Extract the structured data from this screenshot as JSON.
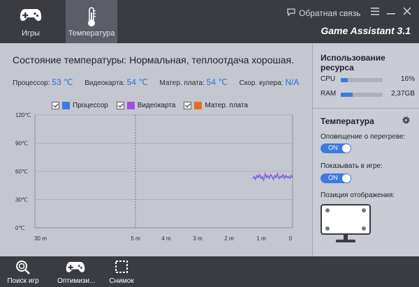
{
  "header": {
    "tabs": [
      {
        "label": "Игры",
        "icon": "gamepad-icon"
      },
      {
        "label": "Температура",
        "icon": "thermometer-icon"
      }
    ],
    "feedback_label": "Обратная связь",
    "brand": "Game Assistant 3.1"
  },
  "status": {
    "text": "Состояние температуры: Нормальная, теплоотдача хорошая."
  },
  "readings": {
    "cpu_label": "Процессор:",
    "cpu_value": "53 ℃",
    "gpu_label": "Видеокарта:",
    "gpu_value": "54 ℃",
    "mb_label": "Матер. плата:",
    "mb_value": "54 ℃",
    "fan_label": "Скор. кулера:",
    "fan_value": "N/A"
  },
  "chart_data": {
    "type": "line",
    "legend": [
      "Процессор",
      "Видеокарта",
      "Матер. плата"
    ],
    "colors": {
      "cpu": "#3b7be0",
      "gpu": "#a24fe0",
      "mb": "#ee6a2a"
    },
    "y_ticks": [
      "120℃",
      "90℃",
      "60℃",
      "30℃",
      "0℃"
    ],
    "ylim": [
      0,
      120
    ],
    "x_ticks": [
      "30 m",
      "5 m",
      "4 m",
      "3 m",
      "2 m",
      "1 m",
      "0"
    ],
    "grid": true,
    "series": [
      {
        "name": "Процессор",
        "values": [
          52,
          54,
          51,
          55,
          53,
          56,
          52,
          54,
          50,
          57,
          53,
          55,
          52,
          56,
          54,
          51,
          55,
          53,
          57,
          52,
          54,
          53,
          56,
          52,
          55,
          53,
          54,
          52,
          55,
          53
        ]
      },
      {
        "name": "Видеокарта",
        "values": [
          53,
          55,
          52,
          56,
          54,
          57,
          53,
          55,
          51,
          58,
          54,
          56,
          53,
          57,
          55,
          52,
          56,
          54,
          58,
          53,
          55,
          54,
          57,
          53,
          56,
          54,
          55,
          53,
          56,
          54
        ]
      }
    ]
  },
  "resources": {
    "title": "Использование ресурса",
    "cpu_label": "CPU",
    "cpu_value": "16%",
    "cpu_fraction": 0.16,
    "ram_label": "RAM",
    "ram_value": "2,37GB",
    "ram_fraction": 0.28
  },
  "temperature_settings": {
    "title": "Температура",
    "overheat_label": "Оповещение о перегреве:",
    "overheat_state": "ON",
    "show_in_game_label": "Показывать в игре:",
    "show_in_game_state": "ON",
    "position_label": "Позиция отображения:"
  },
  "footer": {
    "buttons": [
      {
        "label": "Поиск игр",
        "icon": "search-games-icon"
      },
      {
        "label": "Оптимизи...",
        "icon": "optimize-gamepad-icon"
      },
      {
        "label": "Снимок",
        "icon": "screenshot-icon"
      }
    ]
  }
}
